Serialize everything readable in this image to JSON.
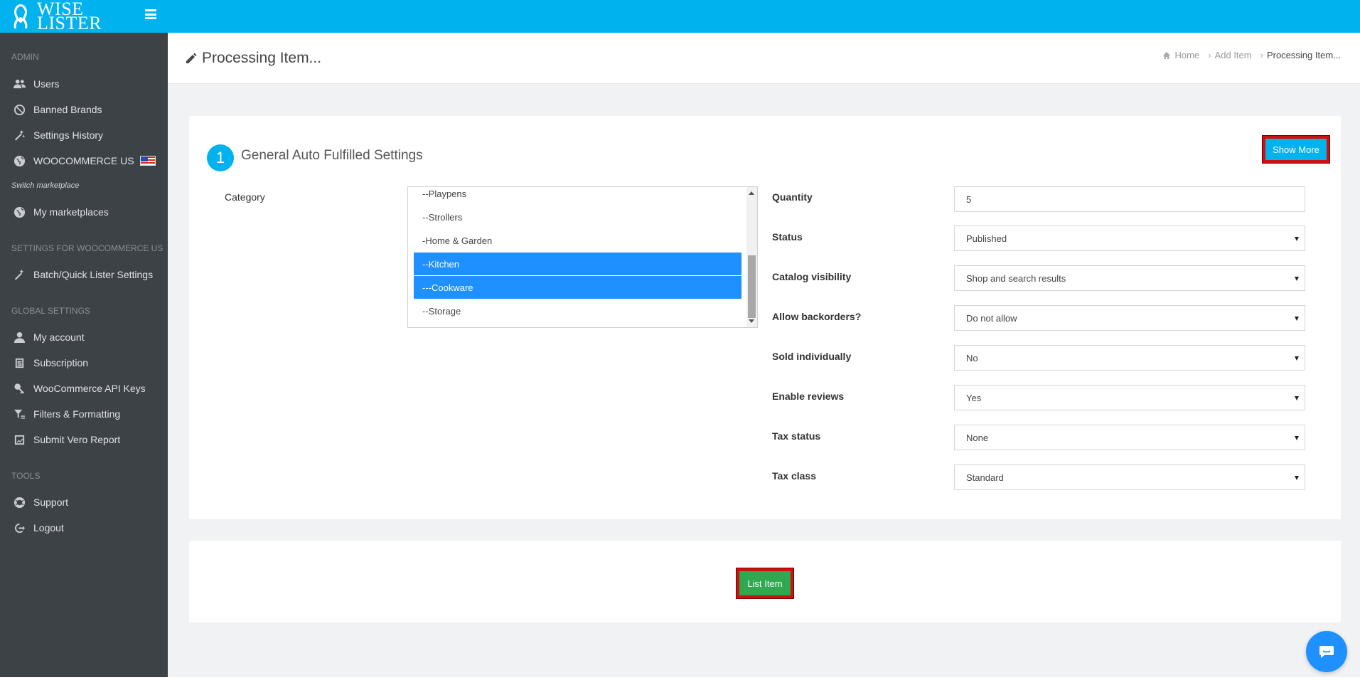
{
  "app": {
    "logo_line1": "WISE",
    "logo_line2": "LISTER"
  },
  "header": {
    "page_title": "Processing Item...",
    "breadcrumb": [
      "Home",
      "Add Item",
      "Processing Item..."
    ]
  },
  "sidebar": {
    "admin_label": "ADMIN",
    "admin_items": [
      {
        "label": "Users",
        "icon": "users-icon"
      },
      {
        "label": "Banned Brands",
        "icon": "banned-icon"
      },
      {
        "label": "Settings History",
        "icon": "wand-icon"
      },
      {
        "label": "WOOCOMMERCE US",
        "icon": "globe-icon"
      }
    ],
    "switch_marketplace": "Switch marketplace",
    "my_marketplaces": "My marketplaces",
    "settings_for_label": "SETTINGS FOR WOOCOMMERCE US",
    "batch_settings": "Batch/Quick Lister Settings",
    "global_label": "GLOBAL SETTINGS",
    "global_items": [
      {
        "label": "My account",
        "icon": "user-icon"
      },
      {
        "label": "Subscription",
        "icon": "subscription-icon"
      },
      {
        "label": "WooCommerce API Keys",
        "icon": "key-icon"
      },
      {
        "label": "Filters & Formatting",
        "icon": "filter-icon"
      },
      {
        "label": "Submit Vero Report",
        "icon": "report-icon"
      }
    ],
    "tools_label": "TOOLS",
    "tools_items": [
      {
        "label": "Support",
        "icon": "support-icon"
      },
      {
        "label": "Logout",
        "icon": "logout-icon"
      }
    ]
  },
  "form": {
    "step_number": "1",
    "title": "General Auto Fulfilled Settings",
    "show_more_label": "Show More",
    "category_label": "Category",
    "category_options": [
      {
        "label": "--Playpens",
        "selected": false
      },
      {
        "label": "--Strollers",
        "selected": false
      },
      {
        "label": "-Home & Garden",
        "selected": false
      },
      {
        "label": "--Kitchen",
        "selected": true
      },
      {
        "label": "---Cookware",
        "selected": true
      },
      {
        "label": "--Storage",
        "selected": false
      }
    ],
    "fields": [
      {
        "label": "Quantity",
        "value": "5",
        "type": "input"
      },
      {
        "label": "Status",
        "value": "Published",
        "type": "select"
      },
      {
        "label": "Catalog visibility",
        "value": "Shop and search results",
        "type": "select"
      },
      {
        "label": "Allow backorders?",
        "value": "Do not allow",
        "type": "select"
      },
      {
        "label": "Sold individually",
        "value": "No",
        "type": "select"
      },
      {
        "label": "Enable reviews",
        "value": "Yes",
        "type": "select"
      },
      {
        "label": "Tax status",
        "value": "None",
        "type": "select"
      },
      {
        "label": "Tax class",
        "value": "Standard",
        "type": "select"
      }
    ],
    "list_item_label": "List Item"
  },
  "colors": {
    "accent": "#00b3ee",
    "sidebar_bg": "#3d4247",
    "selection": "#1e90ff",
    "success": "#2fa84f",
    "highlight_border": "#cc1111"
  }
}
